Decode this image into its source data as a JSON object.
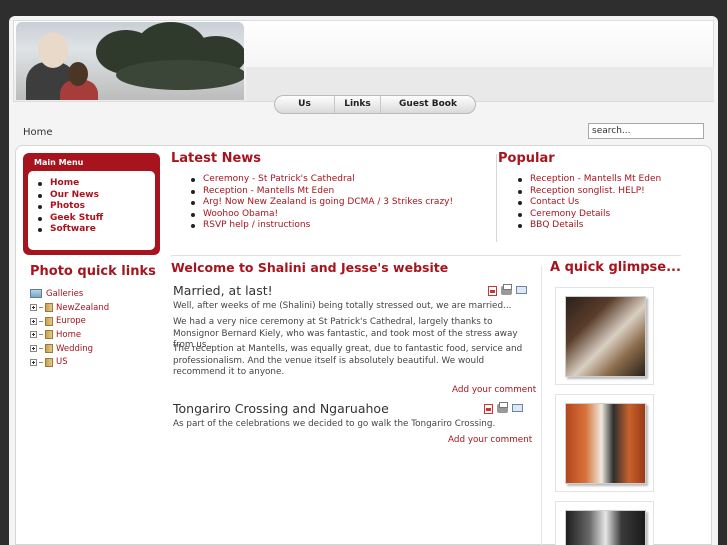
{
  "nav": {
    "items": [
      {
        "label": "Us"
      },
      {
        "label": "Links"
      },
      {
        "label": "Guest Book"
      }
    ]
  },
  "breadcrumb": "Home",
  "search": {
    "value": "search..."
  },
  "main_menu": {
    "title": "Main Menu",
    "items": [
      {
        "label": "Home"
      },
      {
        "label": "Our News"
      },
      {
        "label": "Photos"
      },
      {
        "label": "Geek Stuff"
      },
      {
        "label": "Software"
      }
    ]
  },
  "latest_news": {
    "title": "Latest News",
    "items": [
      "Ceremony - St Patrick's Cathedral",
      "Reception - Mantells Mt Eden",
      "Arg! Now New Zealand is going DCMA / 3 Strikes crazy!",
      "Woohoo Obama!",
      "RSVP help / instructions"
    ]
  },
  "popular": {
    "title": "Popular",
    "items": [
      "Reception - Mantells Mt Eden",
      "Reception songlist. HELP!",
      "Contact Us",
      "Ceremony Details",
      "BBQ Details"
    ]
  },
  "photo_links": {
    "title": "Photo quick links",
    "root": "Galleries",
    "items": [
      "NewZealand",
      "Europe",
      "Home",
      "Wedding",
      "US"
    ]
  },
  "welcome": {
    "title": "Welcome to Shalini and Jesse's website"
  },
  "articles": [
    {
      "title": "Married, at last!",
      "paragraphs": [
        "Well, after weeks of me (Shalini) being totally stressed out, we are married...",
        "We had a very nice ceremony at St Patrick's Cathedral, largely thanks to Monsignor Bernard Kiely, who was fantastic, and took most of the stress away from us..",
        "The reception at Mantells, was equally great, due to fantastic food, service and professionalism. And the venue itself is absolutely beautiful. We would recommend it to anyone."
      ],
      "comment": "Add your comment"
    },
    {
      "title": "Tongariro Crossing and Ngaruahoe",
      "paragraphs": [
        "As part of the celebrations we decided to go walk the Tongariro Crossing."
      ],
      "comment": "Add your comment"
    }
  ],
  "glimpse": {
    "title": "A quick glimpse..."
  },
  "colors": {
    "accent": "#a8141d",
    "background": "#3a3a3a"
  },
  "icons": [
    "pdf-icon",
    "print-icon",
    "email-icon",
    "folder-icon",
    "gallery-icon"
  ]
}
